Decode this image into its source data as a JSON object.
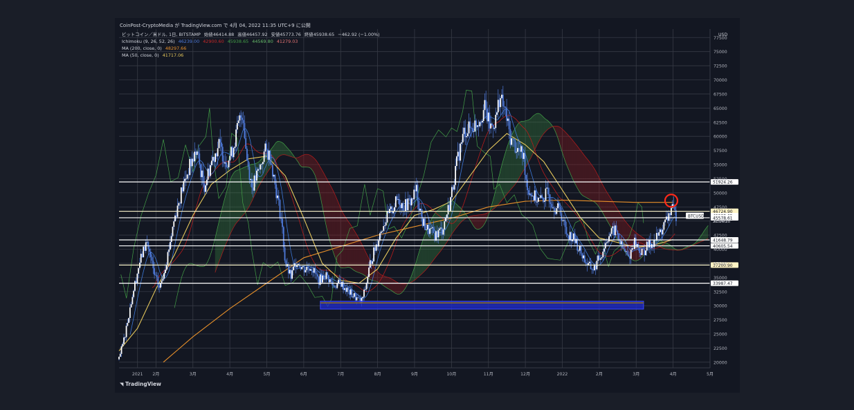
{
  "header": {
    "published": "CoinPost-CryptoMedia が TradingView.com で 4月 04, 2022 11:35 UTC+9 に公開"
  },
  "legend": {
    "symbol_line": {
      "title": "ビットコイン／米ドル, 1日, BITSTAMP",
      "open_label": "始値",
      "open": "46414.88",
      "high_label": "高値",
      "high": "46457.92",
      "low_label": "安値",
      "low": "45773.76",
      "close_label": "終値",
      "close": "45938.65",
      "change": "−462.92 (−1.00%)"
    },
    "ichimoku": {
      "name": "Ichimoku (9, 26, 52, 26)",
      "v1": "46239.00",
      "v2": "42900.60",
      "v3": "45938.65",
      "v4": "44569.80",
      "v5": "41279.03"
    },
    "ma200": {
      "name": "MA (200, close, 0)",
      "value": "48297.66"
    },
    "ma50": {
      "name": "MA (50, close, 0)",
      "value": "41717.06"
    }
  },
  "footer": {
    "brand": "TradingView"
  },
  "colors": {
    "background": "#131722",
    "grid": "#363a45",
    "candle": "#4f7bdc",
    "tenkan": "#3c78d8",
    "kijun": "#b71c1c",
    "chikou": "#43a047",
    "span_a": "#43a047",
    "span_b": "#b71c1c",
    "ma200": "#e8902a",
    "ma50": "#e6c85c",
    "hline": "#ffffff",
    "support_box": "#1f2bd0",
    "highlight_circle": "#ff2a1a"
  },
  "chart_data": {
    "type": "line",
    "title": "ビットコイン／米ドル, 1日, BITSTAMP",
    "xlabel": "",
    "ylabel": "",
    "ylim": [
      19000,
      79000
    ],
    "y_ticks": [
      20000,
      22500,
      25000,
      27500,
      30000,
      32500,
      35000,
      37500,
      40000,
      42500,
      45000,
      47500,
      50000,
      52500,
      55000,
      57500,
      60000,
      62500,
      65000,
      67500,
      70000,
      72500,
      75000,
      77500
    ],
    "currency_label": "USD",
    "x_ticks": [
      {
        "label": "2021",
        "t": 1.5
      },
      {
        "label": "2月",
        "t": 2
      },
      {
        "label": "3月",
        "t": 3
      },
      {
        "label": "4月",
        "t": 4
      },
      {
        "label": "5月",
        "t": 5
      },
      {
        "label": "6月",
        "t": 6
      },
      {
        "label": "7月",
        "t": 7
      },
      {
        "label": "8月",
        "t": 8
      },
      {
        "label": "9月",
        "t": 9
      },
      {
        "label": "10月",
        "t": 10
      },
      {
        "label": "11月",
        "t": 11
      },
      {
        "label": "12月",
        "t": 12
      },
      {
        "label": "2022",
        "t": 13
      },
      {
        "label": "2月",
        "t": 14
      },
      {
        "label": "3月",
        "t": 15
      },
      {
        "label": "4月",
        "t": 16
      },
      {
        "label": "5月",
        "t": 17
      }
    ],
    "price_series": [
      [
        1.0,
        20500
      ],
      [
        1.15,
        24500
      ],
      [
        1.35,
        31500
      ],
      [
        1.55,
        37500
      ],
      [
        1.75,
        41500
      ],
      [
        1.95,
        35500
      ],
      [
        2.1,
        33000
      ],
      [
        2.3,
        38500
      ],
      [
        2.5,
        45500
      ],
      [
        2.7,
        50500
      ],
      [
        2.9,
        54500
      ],
      [
        3.1,
        57500
      ],
      [
        3.3,
        51000
      ],
      [
        3.5,
        55500
      ],
      [
        3.7,
        58500
      ],
      [
        3.9,
        55500
      ],
      [
        4.05,
        57000
      ],
      [
        4.25,
        62500
      ],
      [
        4.35,
        64500
      ],
      [
        4.45,
        56500
      ],
      [
        4.6,
        51000
      ],
      [
        4.8,
        54000
      ],
      [
        4.95,
        57500
      ],
      [
        5.1,
        56500
      ],
      [
        5.25,
        50500
      ],
      [
        5.4,
        45000
      ],
      [
        5.5,
        37500
      ],
      [
        5.65,
        35000
      ],
      [
        5.8,
        38000
      ],
      [
        6.0,
        36500
      ],
      [
        6.2,
        37000
      ],
      [
        6.4,
        34500
      ],
      [
        6.6,
        35500
      ],
      [
        6.8,
        33500
      ],
      [
        7.0,
        34000
      ],
      [
        7.2,
        32500
      ],
      [
        7.4,
        31500
      ],
      [
        7.55,
        30500
      ],
      [
        7.65,
        32500
      ],
      [
        7.8,
        37500
      ],
      [
        7.95,
        40500
      ],
      [
        8.15,
        44500
      ],
      [
        8.35,
        46500
      ],
      [
        8.55,
        49000
      ],
      [
        8.7,
        47500
      ],
      [
        8.9,
        48500
      ],
      [
        9.05,
        50500
      ],
      [
        9.2,
        45000
      ],
      [
        9.35,
        43500
      ],
      [
        9.55,
        42500
      ],
      [
        9.75,
        43500
      ],
      [
        9.95,
        48000
      ],
      [
        10.15,
        55500
      ],
      [
        10.35,
        61000
      ],
      [
        10.55,
        61500
      ],
      [
        10.75,
        63000
      ],
      [
        10.9,
        65000
      ],
      [
        11.05,
        61500
      ],
      [
        11.2,
        63000
      ],
      [
        11.3,
        67000
      ],
      [
        11.45,
        64500
      ],
      [
        11.6,
        59500
      ],
      [
        11.8,
        57500
      ],
      [
        11.95,
        56500
      ],
      [
        12.05,
        51000
      ],
      [
        12.2,
        49500
      ],
      [
        12.4,
        48500
      ],
      [
        12.6,
        50000
      ],
      [
        12.8,
        47500
      ],
      [
        12.95,
        46800
      ],
      [
        13.1,
        43000
      ],
      [
        13.3,
        42000
      ],
      [
        13.5,
        39500
      ],
      [
        13.7,
        37000
      ],
      [
        13.85,
        36500
      ],
      [
        14.05,
        39000
      ],
      [
        14.25,
        42500
      ],
      [
        14.45,
        43500
      ],
      [
        14.6,
        40500
      ],
      [
        14.8,
        38500
      ],
      [
        14.95,
        41500
      ],
      [
        15.15,
        39200
      ],
      [
        15.3,
        40500
      ],
      [
        15.5,
        41500
      ],
      [
        15.7,
        43500
      ],
      [
        15.85,
        45500
      ],
      [
        15.95,
        47200
      ],
      [
        16.05,
        46200
      ],
      [
        16.1,
        45938
      ]
    ],
    "horizontal_levels": [
      {
        "value": 51924.26,
        "label": "51924.26",
        "style": "white"
      },
      {
        "value": 46724.9,
        "label": "46724.90",
        "style": "yellow"
      },
      {
        "value": 45938.65,
        "label": "45938.65",
        "style": "current"
      },
      {
        "value": 45578.61,
        "label": "45578.61",
        "style": "white"
      },
      {
        "value": 41648.79,
        "label": "41648.79",
        "style": "white"
      },
      {
        "value": 40605.54,
        "label": "40605.54",
        "style": "white"
      },
      {
        "value": 37200.9,
        "label": "37200.90",
        "style": "yellow"
      },
      {
        "value": 33987.47,
        "label": "33987.47",
        "style": "white"
      }
    ],
    "current_price": {
      "symbol": "BTCUSD",
      "value": "45938.65",
      "countdown": "21:24:38"
    },
    "support_zone": {
      "t_start": 6.45,
      "t_end": 15.2,
      "low": 29600,
      "high": 30500
    },
    "highlight": {
      "t": 15.95,
      "value": 48600
    },
    "series": [
      {
        "name": "MA (200, close, 0)",
        "points": [
          [
            2.2,
            20000
          ],
          [
            3,
            24500
          ],
          [
            4,
            29500
          ],
          [
            5,
            34000
          ],
          [
            6,
            38500
          ],
          [
            7,
            40500
          ],
          [
            8,
            42500
          ],
          [
            9,
            44000
          ],
          [
            10,
            45500
          ],
          [
            11,
            47500
          ],
          [
            12,
            48500
          ],
          [
            13,
            48700
          ],
          [
            14,
            48500
          ],
          [
            15,
            48300
          ],
          [
            16,
            48297
          ]
        ]
      },
      {
        "name": "MA (50, close, 0)",
        "points": [
          [
            1,
            22000
          ],
          [
            1.5,
            26000
          ],
          [
            2,
            33000
          ],
          [
            2.5,
            39000
          ],
          [
            3,
            46000
          ],
          [
            3.5,
            51500
          ],
          [
            4,
            54000
          ],
          [
            4.5,
            56000
          ],
          [
            5,
            56500
          ],
          [
            5.5,
            53000
          ],
          [
            6,
            45500
          ],
          [
            6.5,
            37500
          ],
          [
            7,
            34500
          ],
          [
            7.5,
            34000
          ],
          [
            8,
            36500
          ],
          [
            8.5,
            42000
          ],
          [
            9,
            46000
          ],
          [
            9.5,
            47000
          ],
          [
            10,
            48500
          ],
          [
            10.5,
            53000
          ],
          [
            11,
            57500
          ],
          [
            11.5,
            60500
          ],
          [
            12,
            58500
          ],
          [
            12.5,
            55500
          ],
          [
            13,
            50500
          ],
          [
            13.5,
            45500
          ],
          [
            14,
            42000
          ],
          [
            14.5,
            41200
          ],
          [
            15,
            40300
          ],
          [
            15.5,
            40800
          ],
          [
            16,
            41717
          ]
        ]
      }
    ]
  }
}
